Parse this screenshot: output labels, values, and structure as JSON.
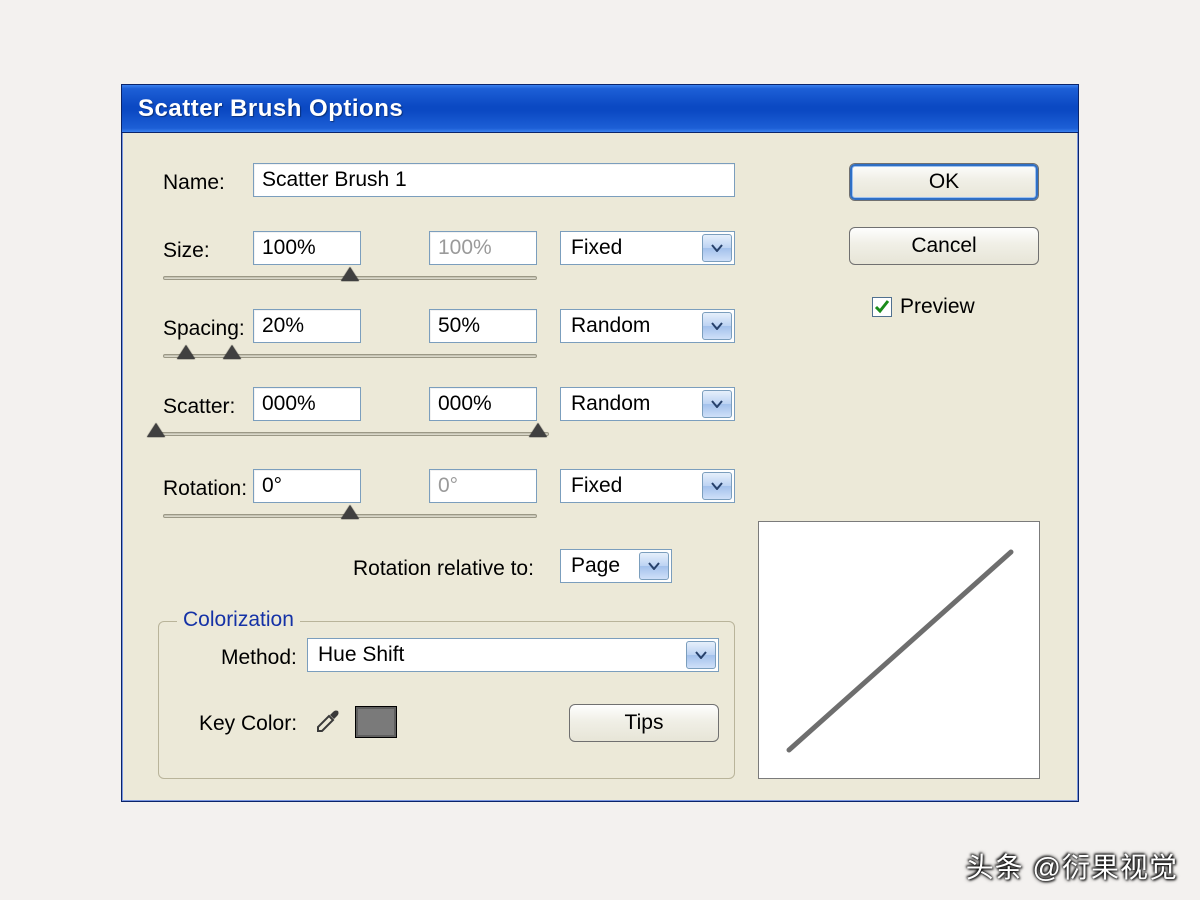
{
  "window": {
    "title": "Scatter Brush Options"
  },
  "fields": {
    "name_label": "Name:",
    "name_value": "Scatter Brush 1",
    "size_label": "Size:",
    "size_a": "100%",
    "size_b": "100%",
    "size_mode": "Fixed",
    "spacing_label": "Spacing:",
    "spacing_a": "20%",
    "spacing_b": "50%",
    "spacing_mode": "Random",
    "scatter_label": "Scatter:",
    "scatter_a": "000%",
    "scatter_b": "000%",
    "scatter_mode": "Random",
    "rotation_label": "Rotation:",
    "rotation_a": "0°",
    "rotation_b": "0°",
    "rotation_mode": "Fixed",
    "rotation_relative_label": "Rotation relative to:",
    "rotation_relative_value": "Page"
  },
  "colorization": {
    "legend": "Colorization",
    "method_label": "Method:",
    "method_value": "Hue Shift",
    "key_color_label": "Key Color:",
    "key_color_hex": "#7a7a7a",
    "tips_label": "Tips"
  },
  "buttons": {
    "ok": "OK",
    "cancel": "Cancel",
    "preview_label": "Preview",
    "preview_checked": true
  },
  "watermark": "头条 @衍果视觉"
}
